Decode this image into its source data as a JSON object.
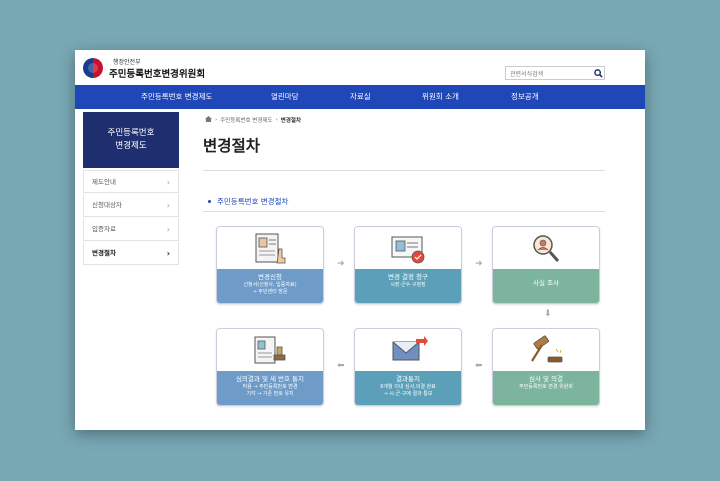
{
  "header": {
    "ministry": "행정안전부",
    "org_name": "주민등록번호변경위원회",
    "search_placeholder": "관련서식검색"
  },
  "nav": {
    "items": [
      "주민등록번호 변경제도",
      "열린마당",
      "자료실",
      "위원회 소개",
      "정보공개"
    ]
  },
  "sidebar": {
    "title_line1": "주민등록번호",
    "title_line2": "변경제도",
    "items": [
      {
        "label": "제도안내",
        "active": false
      },
      {
        "label": "신청대상자",
        "active": false
      },
      {
        "label": "입증자료",
        "active": false
      },
      {
        "label": "변경절차",
        "active": true
      }
    ]
  },
  "breadcrumb": {
    "items": [
      "주민등록번호 변경제도",
      "변경절차"
    ]
  },
  "main": {
    "title": "변경절차",
    "section_title": "주민등록번호 변경절차",
    "steps": [
      {
        "name": "변경신청",
        "desc1": "신청서(신청사, 입증자료)",
        "desc2": "→ 주민센터 방문",
        "color": "#6f9bc8"
      },
      {
        "name": "변경 결정 청구",
        "desc1": "시장·군수·구청장",
        "desc2": "",
        "color": "#5ba0b8"
      },
      {
        "name": "사실 조사",
        "desc1": "",
        "desc2": "",
        "color": "#7cb49e"
      },
      {
        "name": "심사 및 의결",
        "desc1": "주민등록번호 변경 위원회",
        "desc2": "",
        "color": "#7cb49e"
      },
      {
        "name": "결과통지",
        "desc1": "6개월 이내 심사,의결 완료",
        "desc2": "→ 시·군·구에 결과 통보",
        "color": "#5ba0b8"
      },
      {
        "name": "심의결과 및 새 번호 통지",
        "desc1": "허용 → 주민등록번호 변경",
        "desc2": "기각 → 기존 번호 유지",
        "color": "#6f9bc8"
      }
    ]
  }
}
